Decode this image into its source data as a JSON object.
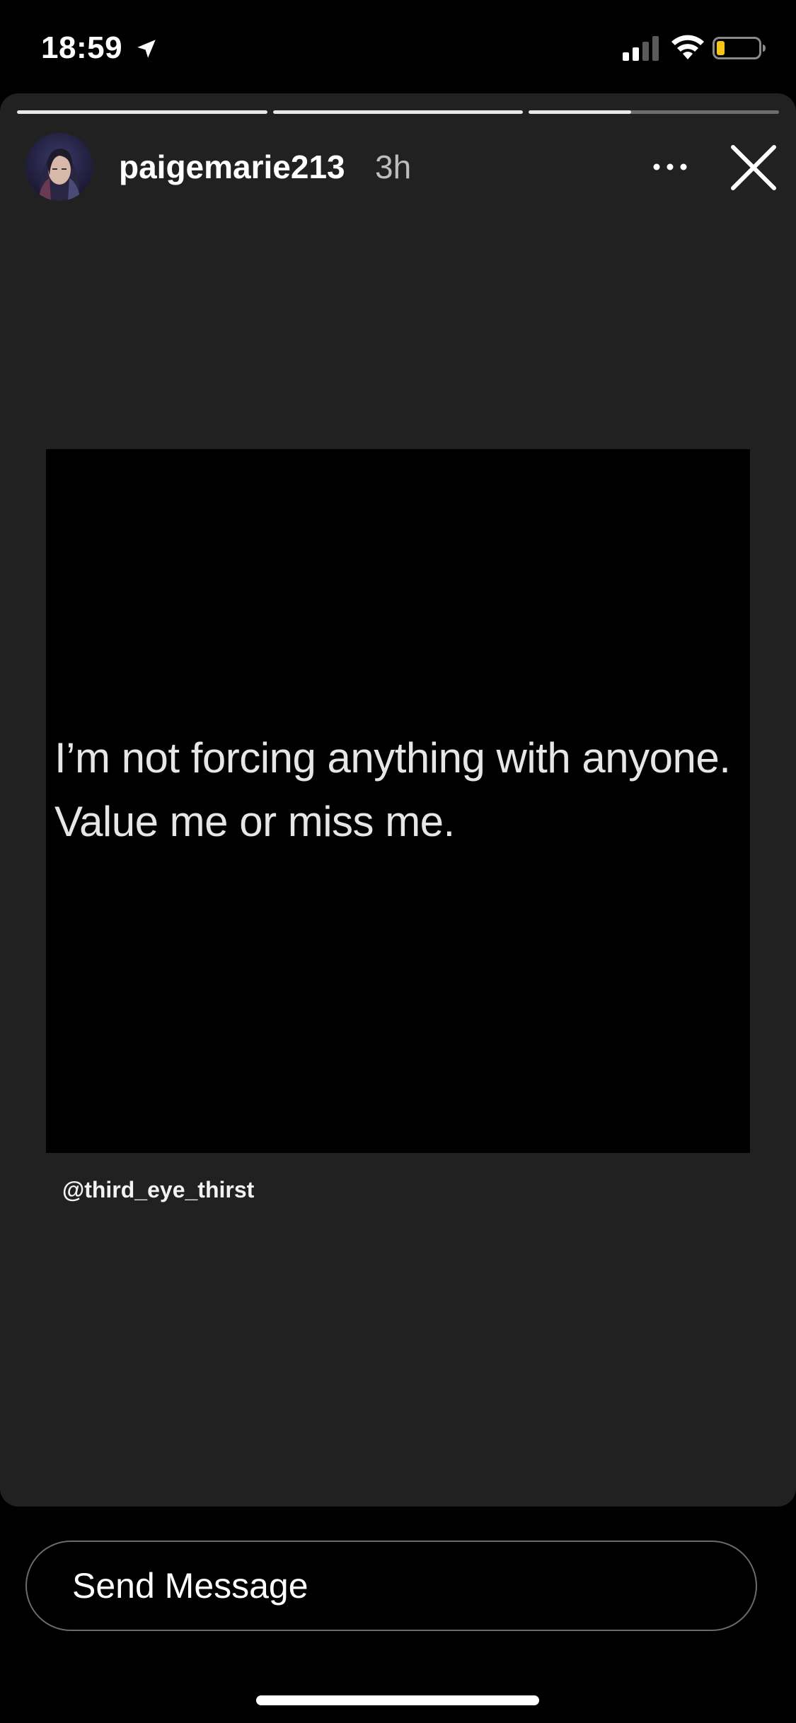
{
  "status_bar": {
    "time": "18:59",
    "location_icon": "location-arrow-icon",
    "signal_icon": "cellular-signal-icon",
    "wifi_icon": "wifi-icon",
    "battery_icon": "battery-low-icon",
    "battery_color": "#f5c518"
  },
  "story": {
    "progress": [
      1.0,
      1.0,
      0.41
    ],
    "username": "paigemarie213",
    "time_ago": "3h",
    "more_icon": "more-horizontal-icon",
    "close_icon": "close-icon",
    "quote_lines": "I’m not forcing anything with anyone.\nValue me or miss me.",
    "mention": "@third_eye_thirst"
  },
  "composer": {
    "placeholder": "Send Message"
  },
  "colors": {
    "card_background": "#212121",
    "page_background": "#000000"
  }
}
